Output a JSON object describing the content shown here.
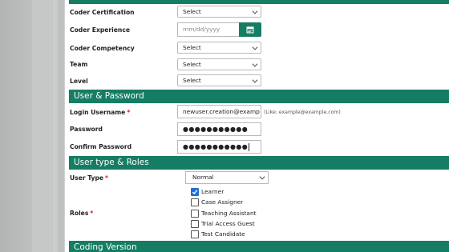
{
  "fields": {
    "coder_certification": {
      "label": "Coder Certification",
      "value": "Select"
    },
    "coder_experience": {
      "label": "Coder Experience",
      "placeholder": "mm/dd/yyyy"
    },
    "coder_competency": {
      "label": "Coder Competency",
      "value": "Select"
    },
    "team": {
      "label": "Team",
      "value": "Select"
    },
    "level": {
      "label": "Level",
      "value": "Select"
    }
  },
  "user_password_section": {
    "title": "User & Password",
    "login_username": {
      "label": "Login Username",
      "required": "*",
      "value": "newuser.creation@examp",
      "hint": "(Like: example@example.com)"
    },
    "password": {
      "label": "Password",
      "value": "●●●●●●●●●●●"
    },
    "confirm_password": {
      "label": "Confirm Password",
      "value": "●●●●●●●●●●●"
    }
  },
  "user_type_section": {
    "title": "User type & Roles",
    "user_type": {
      "label": "User Type",
      "required": "*",
      "value": "Normal"
    },
    "roles": {
      "label": "Roles",
      "required": "*",
      "options": [
        {
          "label": "Learner",
          "checked": true
        },
        {
          "label": "Case Assigner",
          "checked": false
        },
        {
          "label": "Teaching Assistant",
          "checked": false
        },
        {
          "label": "Trial Access Guest",
          "checked": false
        },
        {
          "label": "Test Candidate",
          "checked": false
        }
      ]
    }
  },
  "coding_version_section": {
    "title": "Coding Version"
  },
  "icons": {
    "calendar": "calendar-icon",
    "select_arrow": "chevron-down-icon",
    "checkbox_check": "check-icon"
  },
  "colors": {
    "accent": "#157d64",
    "checkbox": "#1f6fd6",
    "required": "#d12020"
  }
}
